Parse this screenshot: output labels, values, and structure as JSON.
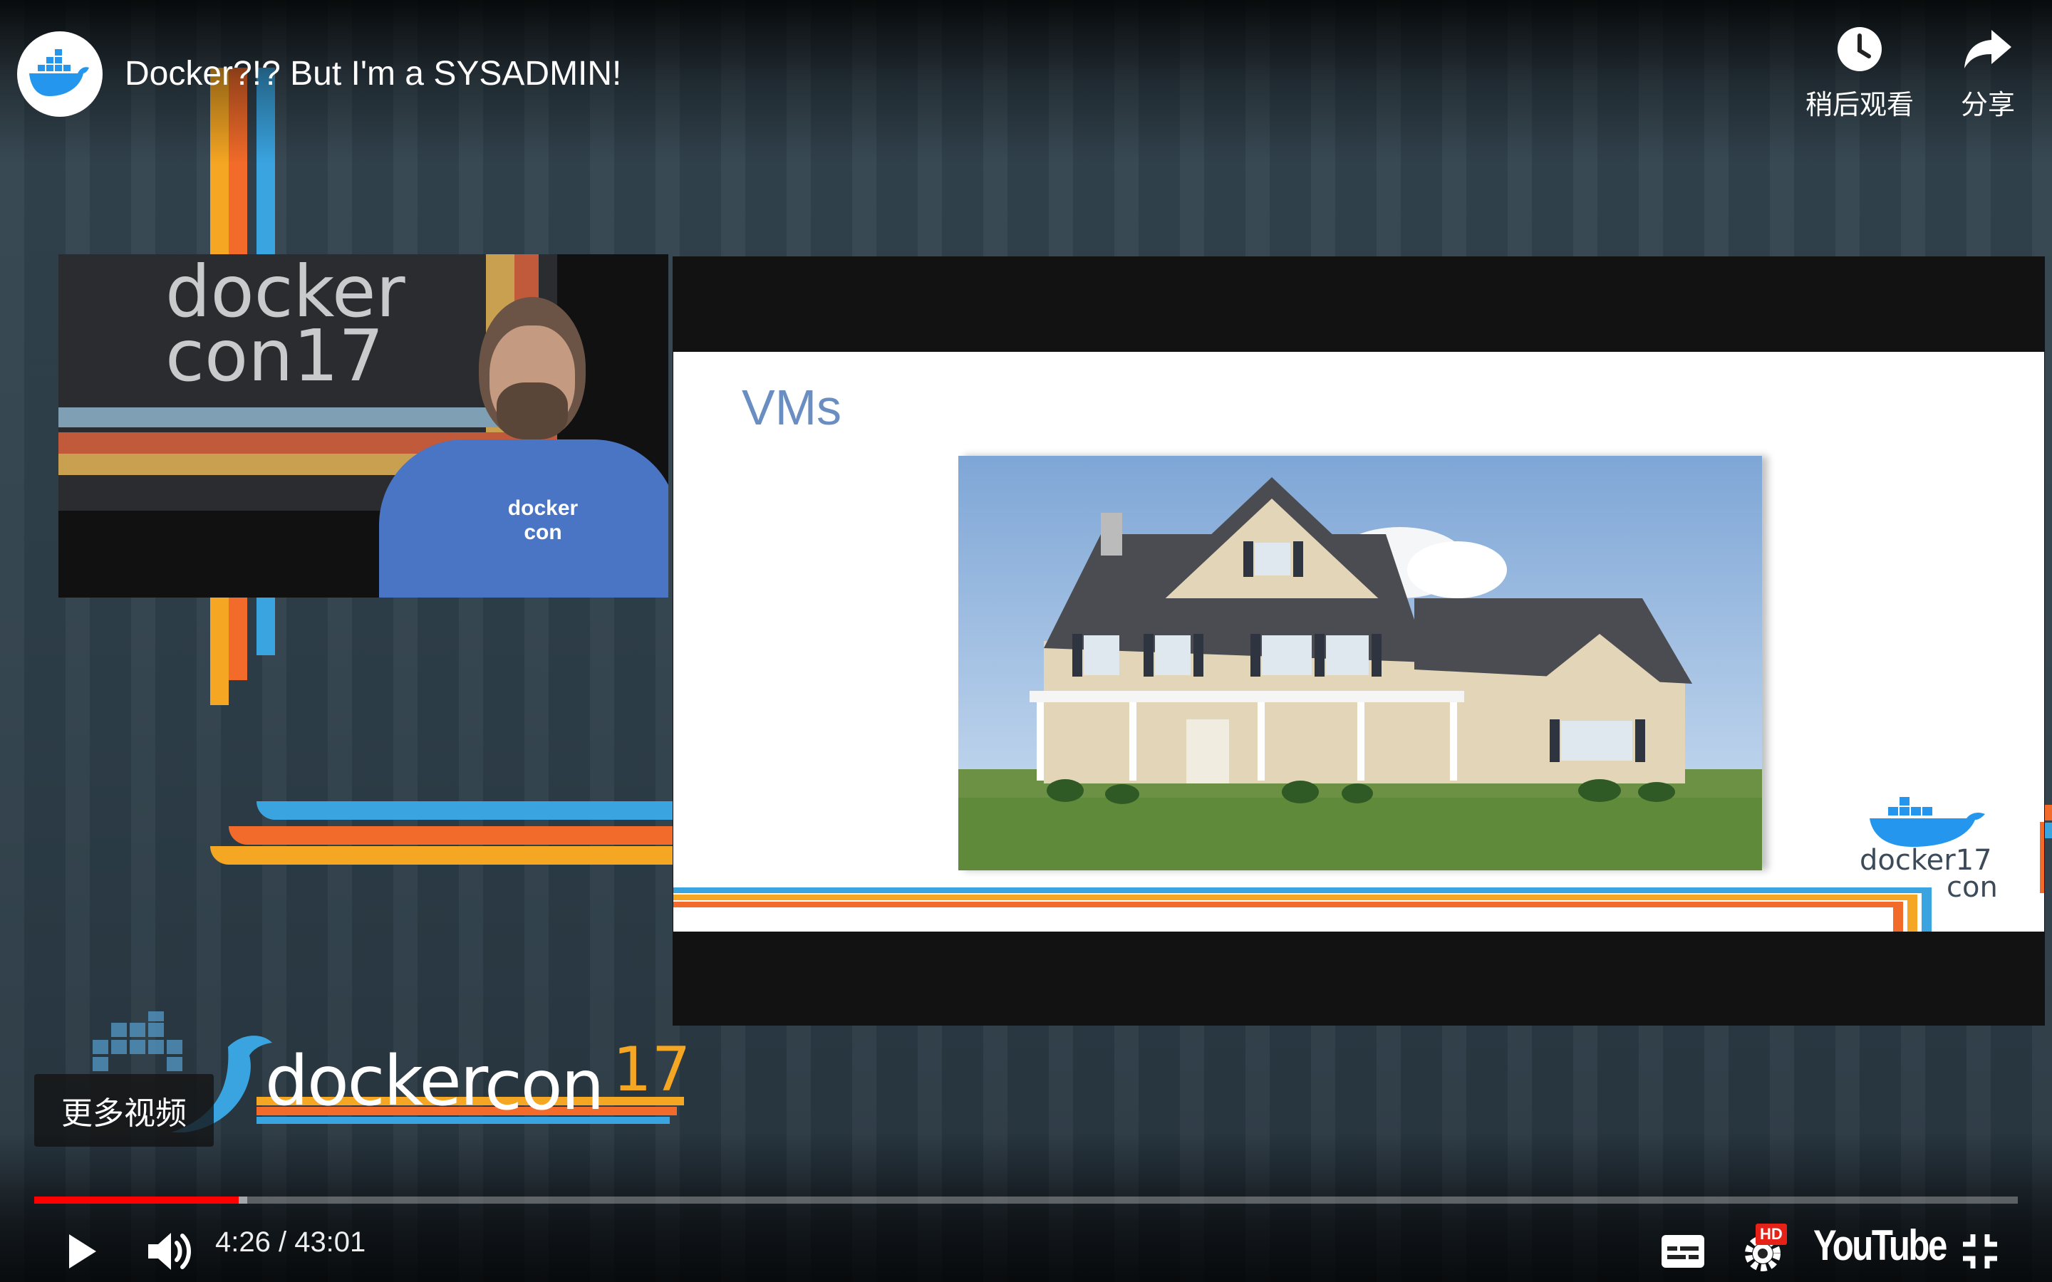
{
  "video": {
    "title": "Docker?!? But I'm a SYSADMIN!",
    "channel_icon": "docker-whale-icon"
  },
  "top_actions": {
    "watch_later": {
      "label": "稍后观看",
      "icon": "clock-icon"
    },
    "share": {
      "label": "分享",
      "icon": "share-arrow-icon"
    }
  },
  "camera": {
    "banner_text_line1": "docker",
    "banner_text_line2": "con17",
    "shirt_text": "docker con"
  },
  "slide": {
    "title": "VMs",
    "logo_text_line1": "docker17",
    "logo_text_line2": "con"
  },
  "event_logo": {
    "text_docker": "docker",
    "text_con": "con",
    "text_year": "17"
  },
  "more_videos": {
    "label": "更多视频"
  },
  "player": {
    "current_time": "4:26",
    "duration": "43:01",
    "time_display": "4:26 / 43:01",
    "played_fraction": 0.1031,
    "buffered_fraction": 0.1075,
    "quality_badge": "HD",
    "brand": "YouTube",
    "icons": {
      "play": "play-icon",
      "volume": "volume-icon",
      "captions": "captions-icon",
      "settings": "settings-gear-icon",
      "exit_fullscreen": "exit-fullscreen-icon"
    }
  },
  "colors": {
    "progress_played": "#ff0000",
    "hd_badge": "#e62117",
    "docker_blue": "#2496ed",
    "stripe_orange": "#f26b2a",
    "stripe_yellow": "#f5a623",
    "stripe_blue": "#3aa4e0",
    "slide_title": "#6a8dc2"
  }
}
